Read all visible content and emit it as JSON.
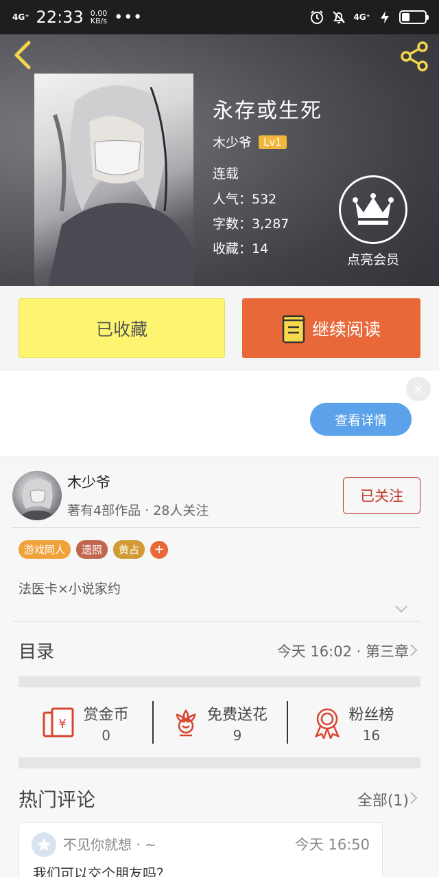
{
  "status_bar": {
    "network": "4G⁺",
    "time": "22:33",
    "speed_value": "0.00",
    "speed_unit": "KB/s",
    "more": "•••",
    "network_right": "4G⁺"
  },
  "book": {
    "title": "永存或生死",
    "author": "木少爷",
    "level": "Lv1",
    "status": "连载",
    "popularity": "人气：532",
    "word_count": "字数：3,287",
    "favorites": "收藏：14",
    "vip_label": "点亮会员"
  },
  "actions": {
    "favorited_label": "已收藏",
    "continue_label": "继续阅读"
  },
  "ad": {
    "close": "×",
    "detail_label": "查看详情"
  },
  "author_card": {
    "name": "木少爷",
    "meta": "著有4部作品 · 28人关注",
    "follow_label": "已关注",
    "tags": [
      {
        "label": "游戏同人",
        "color": "#f0a23a"
      },
      {
        "label": "遗照",
        "color": "#c2674f"
      },
      {
        "label": "黄占",
        "color": "#d29a34"
      }
    ],
    "tag_plus": "+",
    "description": "法医卡×小说家约"
  },
  "catalog": {
    "title": "目录",
    "latest": "今天 16:02 · 第三章"
  },
  "stats": [
    {
      "label": "赏金币",
      "value": "0",
      "icon": "red-envelope-icon"
    },
    {
      "label": "免费送花",
      "value": "9",
      "icon": "flower-icon"
    },
    {
      "label": "粉丝榜",
      "value": "16",
      "icon": "medal-icon"
    }
  ],
  "comments": {
    "title": "热门评论",
    "all_label": "全部(1)",
    "items": [
      {
        "user": "不见你就想 · ~",
        "time": "今天 16:50",
        "text": "我们可以交个朋友吗？"
      }
    ]
  },
  "colors": {
    "accent_orange": "#e8683a",
    "fav_yellow": "#fdf46f",
    "follow_red": "#c0392b",
    "detail_blue": "#5ba2ea",
    "level_gold": "#f2b63b"
  }
}
